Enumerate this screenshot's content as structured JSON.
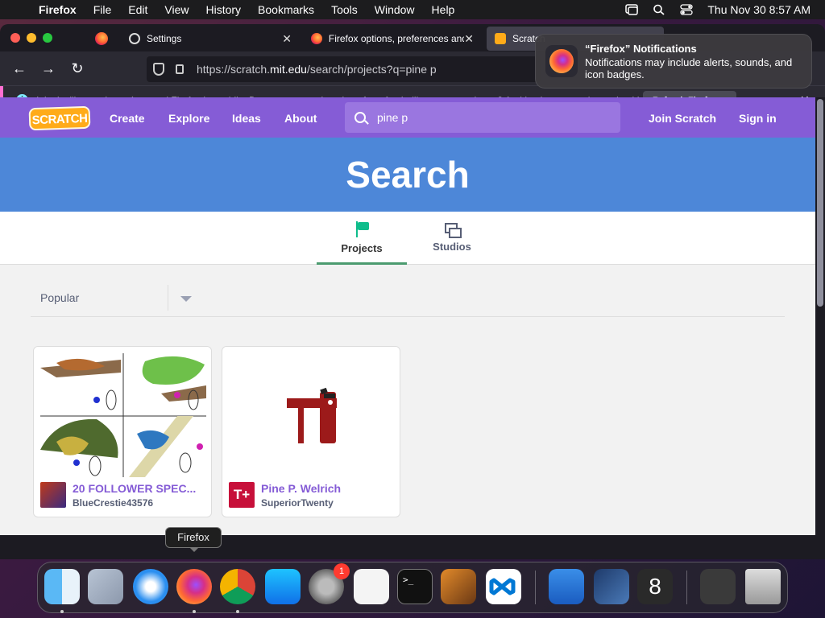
{
  "menubar": {
    "app_name": "Firefox",
    "items": [
      "File",
      "Edit",
      "View",
      "History",
      "Bookmarks",
      "Tools",
      "Window",
      "Help"
    ],
    "clock": "Thu Nov 30  8:57 AM"
  },
  "browser": {
    "tabs": [
      {
        "label": "Settings"
      },
      {
        "label": "Firefox options, preferences and"
      },
      {
        "label": "Scratch"
      }
    ],
    "url_prefix": "https://scratch.",
    "url_domain": "mit.edu",
    "url_suffix": "/search/projects?q=pine p",
    "infobar": {
      "message": "It looks like you haven’t started Firefox in a while. Do you want to clean it up for a fresh, like-new experience? And by the way, welcome back!",
      "button": "Refresh Firefox…",
      "info_glyph": "i"
    }
  },
  "notification": {
    "title": "“Firefox” Notifications",
    "body": "Notifications may include alerts, sounds, and icon badges."
  },
  "scratch": {
    "logo": "SCRATCH",
    "nav": {
      "create": "Create",
      "explore": "Explore",
      "ideas": "Ideas",
      "about": "About",
      "join": "Join Scratch",
      "signin": "Sign in"
    },
    "search_query": "pine p",
    "banner": "Search",
    "tabs": {
      "projects": "Projects",
      "studios": "Studios"
    },
    "sort": "Popular",
    "results": [
      {
        "title": "20 FOLLOWER SPEC...",
        "author": "BlueCrestie43576"
      },
      {
        "title": "Pine P. Welrich",
        "author": "SuperiorTwenty",
        "avatar_text": "T+"
      }
    ]
  },
  "dock": {
    "tooltip": "Firefox",
    "badge_count": "1",
    "items": [
      "Finder",
      "Launchpad",
      "Safari",
      "Firefox",
      "Chrome",
      "App Store",
      "System Settings",
      "TextEdit",
      "Terminal",
      "GarageBand",
      "Visual Studio Code",
      "Weather",
      "Xcode",
      "Perplexity",
      "Recent",
      "Trash"
    ]
  },
  "colors": {
    "scratch_purple": "#855cd6",
    "search_blue": "#4d87d8",
    "active_tab_green": "#4b9b6f"
  }
}
